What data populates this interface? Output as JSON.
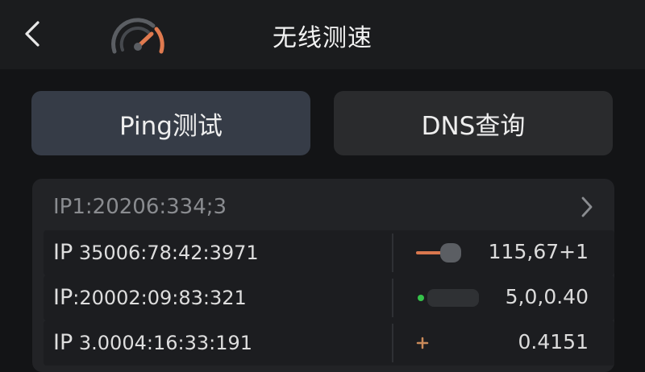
{
  "header": {
    "title": "无线测速",
    "back_icon": "chevron-left-icon",
    "logo_icon": "speedometer-icon",
    "accent": "#e07a4f"
  },
  "actions": [
    {
      "label": "Ping测试"
    },
    {
      "label": "DNS查询"
    }
  ],
  "panel": {
    "header_ip": "IP1:20206:334;3",
    "header_chevron_icon": "chevron-right-icon",
    "rows": [
      {
        "ip_prefix": "IP",
        "ip": " 35006:78:42:3971",
        "value": "115,67+1",
        "indicator": "orange-bar",
        "indicator_color": "#d9774e"
      },
      {
        "ip_prefix": "IP",
        "ip": ":20002:09:83:321",
        "value": "5,0,0.40",
        "indicator": "green-dot",
        "indicator_color": "#35c24a"
      },
      {
        "ip_prefix": "IP",
        "ip": " 3.0004:16:33:191",
        "value": "0.4151",
        "indicator": "plus",
        "indicator_color": "#c98a5a"
      }
    ]
  }
}
